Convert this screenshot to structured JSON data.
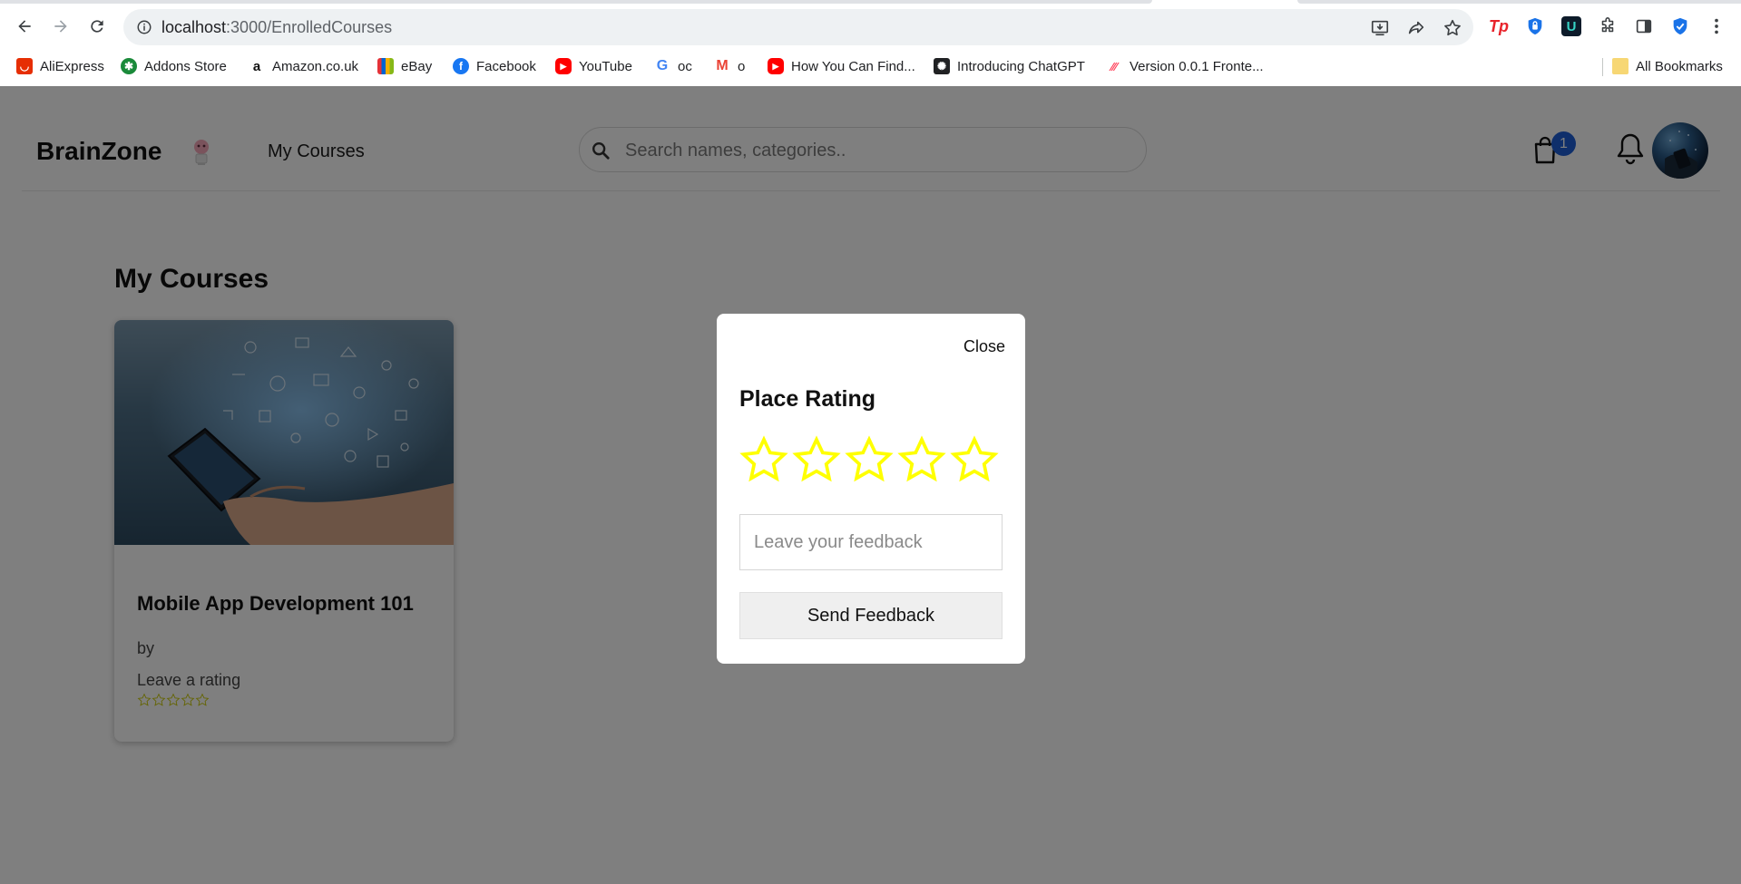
{
  "browser": {
    "url_host": "localhost",
    "url_path": ":3000/EnrolledCourses",
    "bookmarks": [
      {
        "label": "AliExpress",
        "icon": "aliexpress-icon",
        "color": "#e62e04"
      },
      {
        "label": "Addons Store",
        "icon": "addons-store-icon",
        "color": "#1a8a3a"
      },
      {
        "label": "Amazon.co.uk",
        "icon": "amazon-icon",
        "color": "#111111"
      },
      {
        "label": "eBay",
        "icon": "ebay-icon",
        "color": "#e53238"
      },
      {
        "label": "Facebook",
        "icon": "facebook-icon",
        "color": "#1877f2"
      },
      {
        "label": "YouTube",
        "icon": "youtube-icon",
        "color": "#ff0000"
      },
      {
        "label": "oc",
        "icon": "google-icon",
        "color": "#4285f4"
      },
      {
        "label": "o",
        "icon": "gmail-icon",
        "color": "#ea4335"
      },
      {
        "label": "How You Can Find...",
        "icon": "youtube-icon",
        "color": "#ff0000"
      },
      {
        "label": "Introducing ChatGPT",
        "icon": "chatgpt-icon",
        "color": "#202123"
      },
      {
        "label": "Version 0.0.1 Fronte...",
        "icon": "monday-icon",
        "color": "#ff3d57"
      }
    ],
    "all_bookmarks_label": "All Bookmarks"
  },
  "header": {
    "logo": "BrainZone",
    "nav_my_courses": "My Courses",
    "search_placeholder": "Search names, categories..",
    "cart_count": "1"
  },
  "main": {
    "section_title": "My Courses",
    "course": {
      "title": "Mobile App Development 101",
      "by": "by",
      "rating_label": "Leave a rating",
      "rating": 0,
      "star_color": "#c8c800"
    }
  },
  "modal": {
    "close_label": "Close",
    "title": "Place Rating",
    "rating": 0,
    "star_color": "#ffff00",
    "feedback_placeholder": "Leave your feedback",
    "send_label": "Send Feedback"
  }
}
